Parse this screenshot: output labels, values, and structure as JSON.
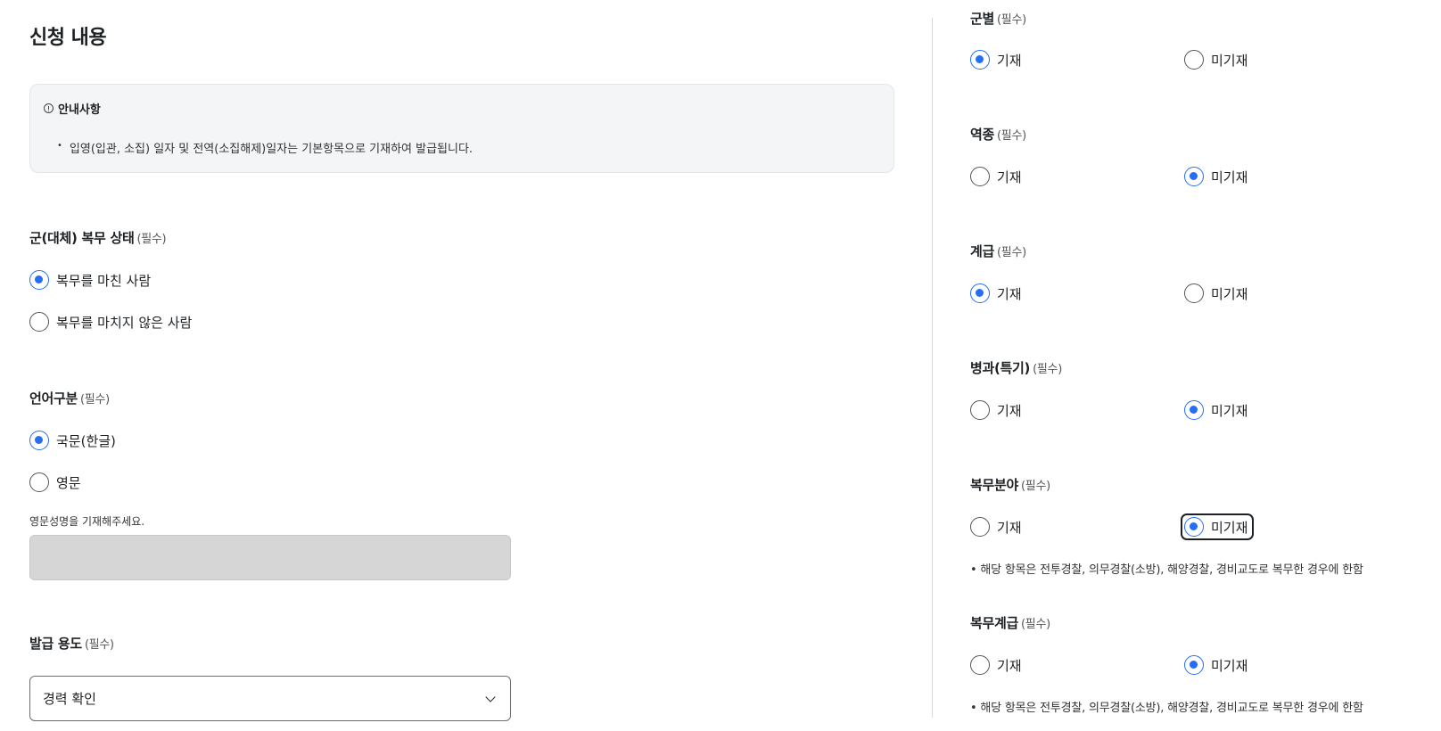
{
  "page_title": "신청 내용",
  "notice": {
    "title": "안내사항",
    "items": [
      "입영(입관, 소집) 일자 및 전역(소집해제)일자는 기본항목으로 기재하여 발급됩니다."
    ]
  },
  "required_mark": "(필수)",
  "service_status": {
    "label": "군(대체) 복무 상태",
    "options": [
      "복무를 마친 사람",
      "복무를 마치지 않은 사람"
    ],
    "selected": 0
  },
  "language": {
    "label": "언어구분",
    "options": [
      "국문(한글)",
      "영문"
    ],
    "selected": 0,
    "english_name_label": "영문성명을 기재해주세요.",
    "english_name_value": ""
  },
  "purpose": {
    "label": "발급 용도",
    "selected_value": "경력 확인"
  },
  "right_fields": [
    {
      "label": "군별",
      "options": [
        "기재",
        "미기재"
      ],
      "selected": 0
    },
    {
      "label": "역종",
      "options": [
        "기재",
        "미기재"
      ],
      "selected": 1
    },
    {
      "label": "계급",
      "options": [
        "기재",
        "미기재"
      ],
      "selected": 0
    },
    {
      "label": "병과(특기)",
      "options": [
        "기재",
        "미기재"
      ],
      "selected": 1
    },
    {
      "label": "복무분야",
      "options": [
        "기재",
        "미기재"
      ],
      "selected": 1,
      "note": "• 해당 항목은 전투경찰, 의무경찰(소방), 해양경찰, 경비교도로 복무한 경우에 한함"
    },
    {
      "label": "복무계급",
      "options": [
        "기재",
        "미기재"
      ],
      "selected": 1,
      "note": "• 해당 항목은 전투경찰, 의무경찰(소방), 해양경찰, 경비교도로 복무한 경우에 한함"
    }
  ],
  "colors": {
    "accent": "#256ef4",
    "notice_bg": "#f4f5f6",
    "disabled_input": "#d6d6d6"
  }
}
